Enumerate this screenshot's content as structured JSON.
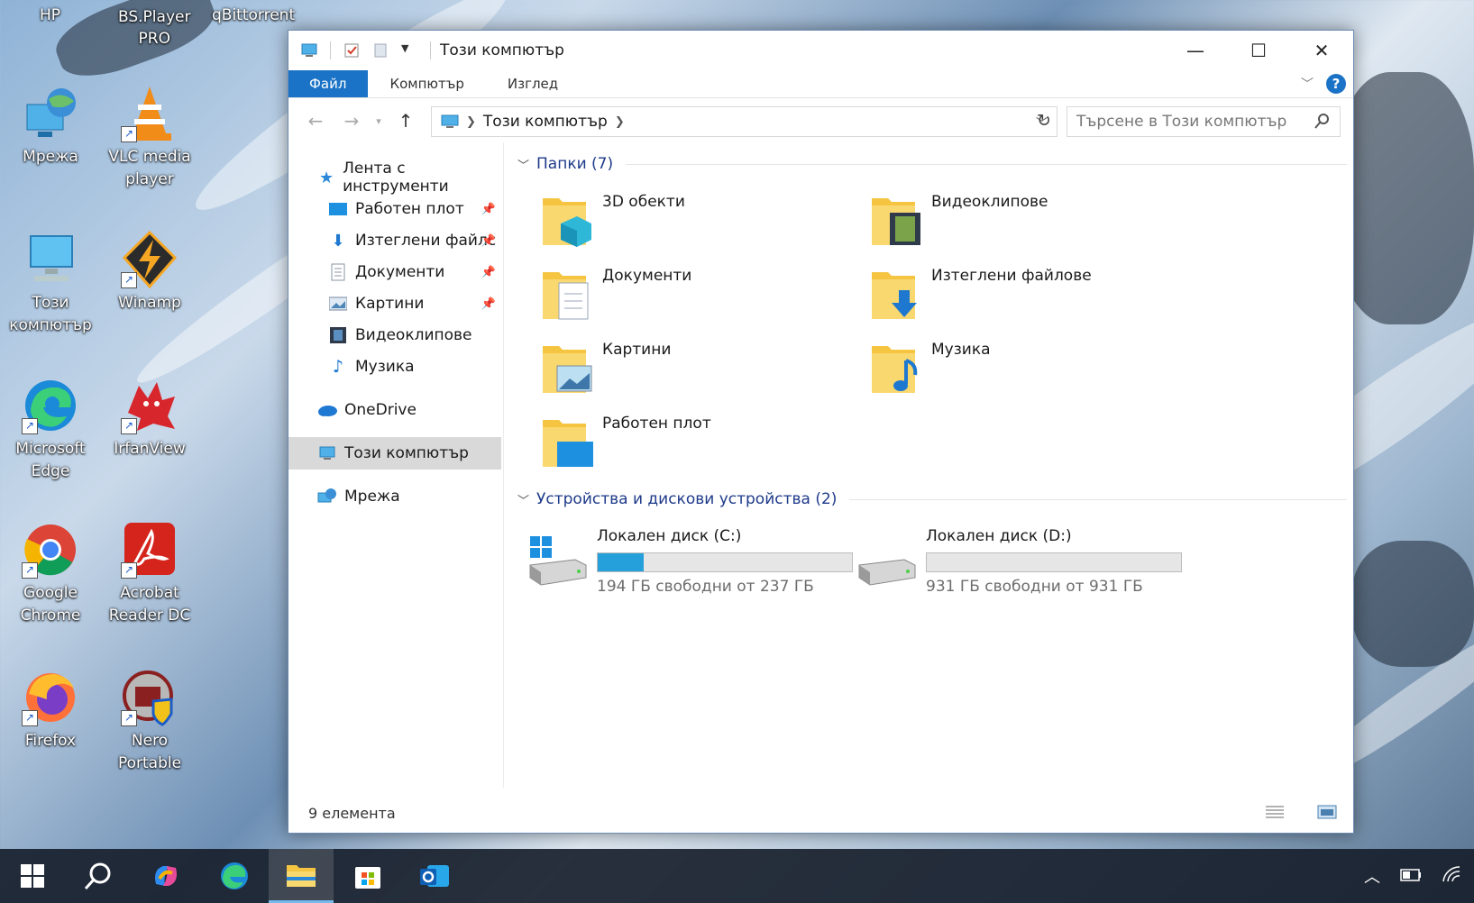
{
  "desktop": {
    "top_labels": [
      "HP",
      "BS.Player\nPRO",
      "qBittorrent"
    ],
    "icons": [
      {
        "label": "Мрежа",
        "icon": "network-globe-icon"
      },
      {
        "label": "VLC media\nplayer",
        "icon": "vlc-cone-icon"
      },
      {
        "label": "Този\nкомпютър",
        "icon": "computer-monitor-icon"
      },
      {
        "label": "Winamp",
        "icon": "winamp-bolt-icon"
      },
      {
        "label": "Microsoft\nEdge",
        "icon": "edge-icon"
      },
      {
        "label": "IrfanView",
        "icon": "irfanview-cat-icon"
      },
      {
        "label": "Google\nChrome",
        "icon": "chrome-icon"
      },
      {
        "label": "Acrobat\nReader DC",
        "icon": "acrobat-icon"
      },
      {
        "label": "Firefox",
        "icon": "firefox-icon"
      },
      {
        "label": "Nero\nPortable",
        "icon": "nero-icon"
      }
    ]
  },
  "window": {
    "title": "Този компютър",
    "ribbon_tabs": [
      "Файл",
      "Компютър",
      "Изглед"
    ],
    "address": {
      "crumb": "Този компютър"
    },
    "search": {
      "placeholder": "Търсене в Този компютър"
    },
    "nav_pane": {
      "items": [
        {
          "label": "Лента с инструменти",
          "icon": "star-icon"
        },
        {
          "label": "Работен плот",
          "icon": "desktop-icon",
          "pinned": true
        },
        {
          "label": "Изтеглени файлс",
          "icon": "download-arrow-icon",
          "pinned": true
        },
        {
          "label": "Документи",
          "icon": "documents-icon",
          "pinned": true
        },
        {
          "label": "Картини",
          "icon": "pictures-icon",
          "pinned": true
        },
        {
          "label": "Видеоклипове",
          "icon": "videos-icon"
        },
        {
          "label": "Музика",
          "icon": "music-note-icon"
        },
        {
          "label": "OneDrive",
          "icon": "cloud-icon"
        },
        {
          "label": "Този компютър",
          "icon": "this-pc-icon",
          "selected": true
        },
        {
          "label": "Мрежа",
          "icon": "network-icon"
        }
      ]
    },
    "folders_group": {
      "label": "Папки (7)"
    },
    "folders": [
      {
        "label": "3D обекти",
        "icon": "3d-objects-folder-icon"
      },
      {
        "label": "Видеоклипове",
        "icon": "videos-folder-icon"
      },
      {
        "label": "Документи",
        "icon": "documents-folder-icon"
      },
      {
        "label": "Изтеглени файлове",
        "icon": "downloads-folder-icon"
      },
      {
        "label": "Картини",
        "icon": "pictures-folder-icon"
      },
      {
        "label": "Музика",
        "icon": "music-folder-icon"
      },
      {
        "label": "Работен плот",
        "icon": "desktop-folder-icon"
      }
    ],
    "drives_group": {
      "label": "Устройства и дискови устройства (2)"
    },
    "drives": [
      {
        "label": "Локален диск (C:)",
        "free_text": "194 ГБ свободни от 237 ГБ",
        "used_fraction": 0.18,
        "system": true
      },
      {
        "label": "Локален диск (D:)",
        "free_text": "931 ГБ свободни от 931 ГБ",
        "used_fraction": 0.0,
        "system": false
      }
    ],
    "status": {
      "count": "9 елемента"
    }
  },
  "taskbar": {
    "apps": [
      "start-windows-icon",
      "search-icon",
      "copilot-icon",
      "edge-icon",
      "file-explorer-icon",
      "store-icon",
      "outlook-icon"
    ],
    "active": "file-explorer-icon"
  },
  "colors": {
    "accent": "#1a73c6",
    "drive_fill": "#26a0da",
    "folder_yellow": "#f5c542"
  }
}
